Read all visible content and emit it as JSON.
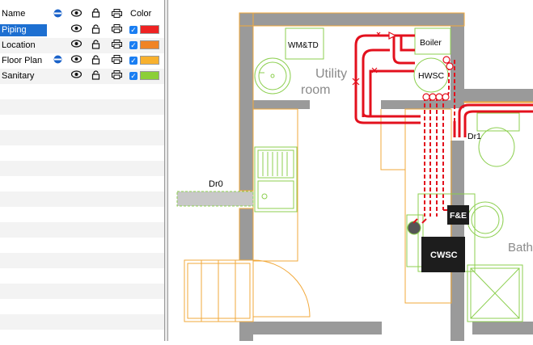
{
  "layers_panel": {
    "headers": {
      "name": "Name",
      "color": "Color"
    },
    "layers": [
      {
        "name": "Piping",
        "color": "#ee2222",
        "selected": true,
        "visible_toggle": false
      },
      {
        "name": "Location",
        "color": "#f08426",
        "selected": false,
        "visible_toggle": false
      },
      {
        "name": "Floor Plan",
        "color": "#f8b12e",
        "selected": false,
        "visible_toggle": true
      },
      {
        "name": "Sanitary",
        "color": "#8ccf37",
        "selected": false,
        "visible_toggle": false
      }
    ]
  },
  "plan": {
    "labels": {
      "wm_td": "WM&TD",
      "boiler": "Boiler",
      "hwsc": "HWSC",
      "utility_room": [
        "Utility",
        "room"
      ],
      "dr0": "Dr0",
      "dr1": "Dr1",
      "fe": "F&E",
      "cwsc": "CWSC",
      "bath": "Bath"
    },
    "colors": {
      "wall": "#9a9a9a",
      "floor_plan": "#f2a93b",
      "sanitary": "#8ccf4f",
      "piping": "#e3101d",
      "equipment": "#1d1d1d"
    }
  }
}
